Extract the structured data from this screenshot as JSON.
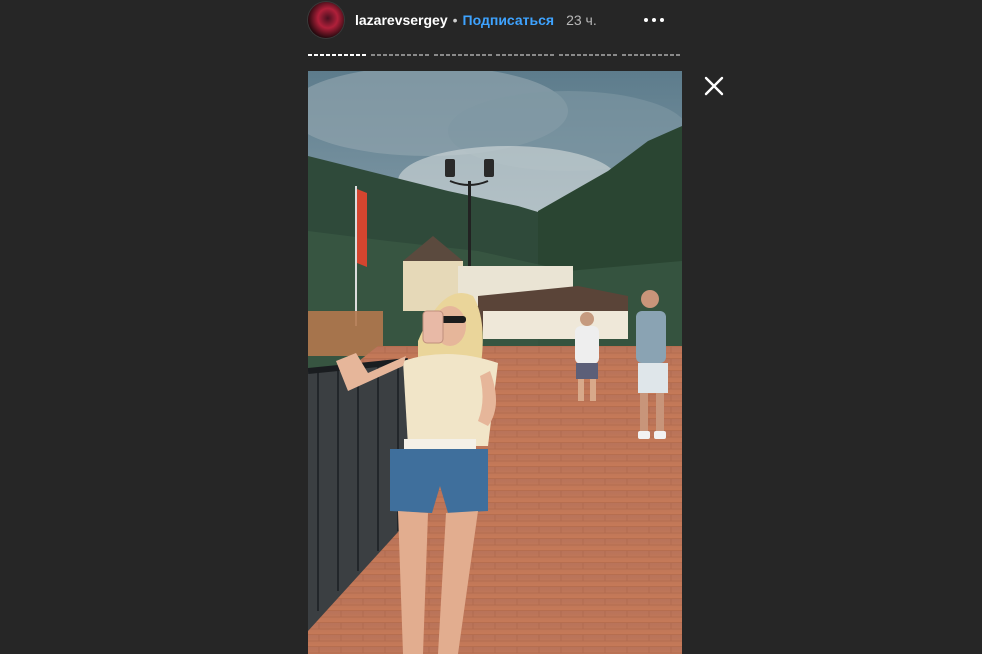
{
  "header": {
    "username": "lazarevsergey",
    "separator": "•",
    "follow_label": "Подписаться",
    "time_ago": "23 ч."
  },
  "progress": {
    "segments": 6,
    "active_index": 0
  },
  "icons": {
    "avatar": "profile-avatar",
    "more": "more-options-icon",
    "close": "close-icon"
  },
  "colors": {
    "background": "#262626",
    "follow": "#3ea3ff",
    "text": "#ffffff"
  }
}
